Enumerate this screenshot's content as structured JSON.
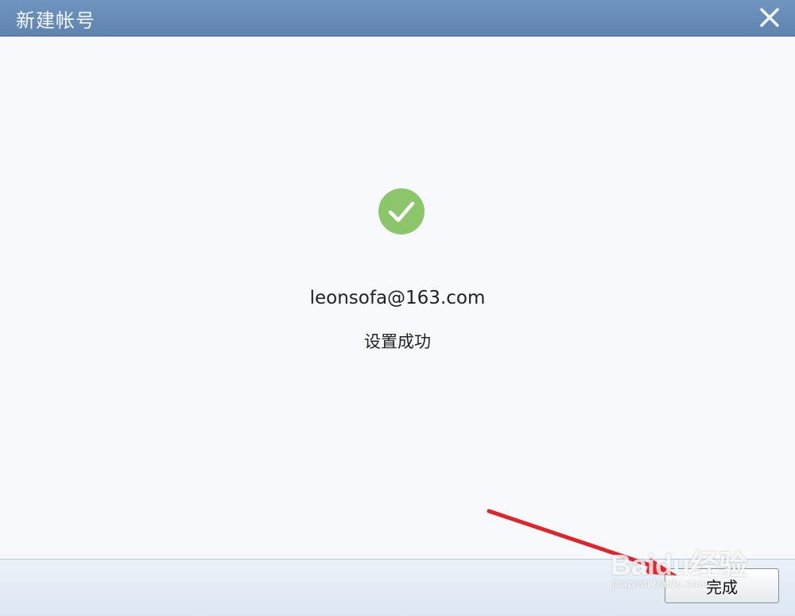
{
  "window": {
    "title": "新建帐号",
    "close_icon": "close-icon"
  },
  "content": {
    "success_icon": "checkmark-circle-icon",
    "email": "leonsofa@163.com",
    "status": "设置成功"
  },
  "footer": {
    "done_label": "完成"
  },
  "annotation": {
    "arrow_color": "#e0242b"
  },
  "watermark": {
    "logo": "Baidu经验",
    "url": "jingyan.baidu.com"
  },
  "colors": {
    "titlebar": "#6a8fba",
    "success": "#8cc66a",
    "background": "#f8f9fc"
  }
}
